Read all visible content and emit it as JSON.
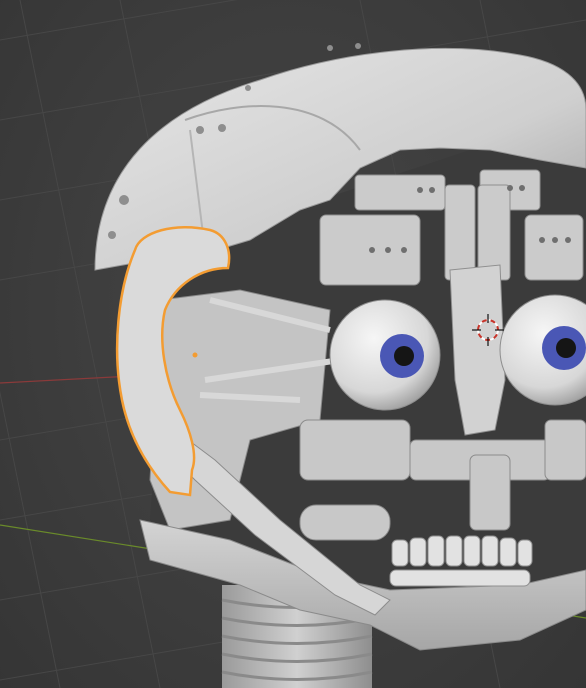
{
  "viewport": {
    "background": "#3d3d3d",
    "grid_color": "#474747",
    "x_axis_color": "#8b3a3a",
    "y_axis_color": "#6a8b2a",
    "selection_outline_color": "#f39c32",
    "selected_object_origin_color": "#f39c32",
    "cursor_color": "#c8342a",
    "mesh_color": "#c9c9c9",
    "iris_color": "#4a57b5",
    "pupil_color": "#151515"
  },
  "scene": {
    "object": "animatronic-head",
    "selected_part": "left-ear-plate",
    "cursor_icon": "3d-cursor-icon"
  }
}
